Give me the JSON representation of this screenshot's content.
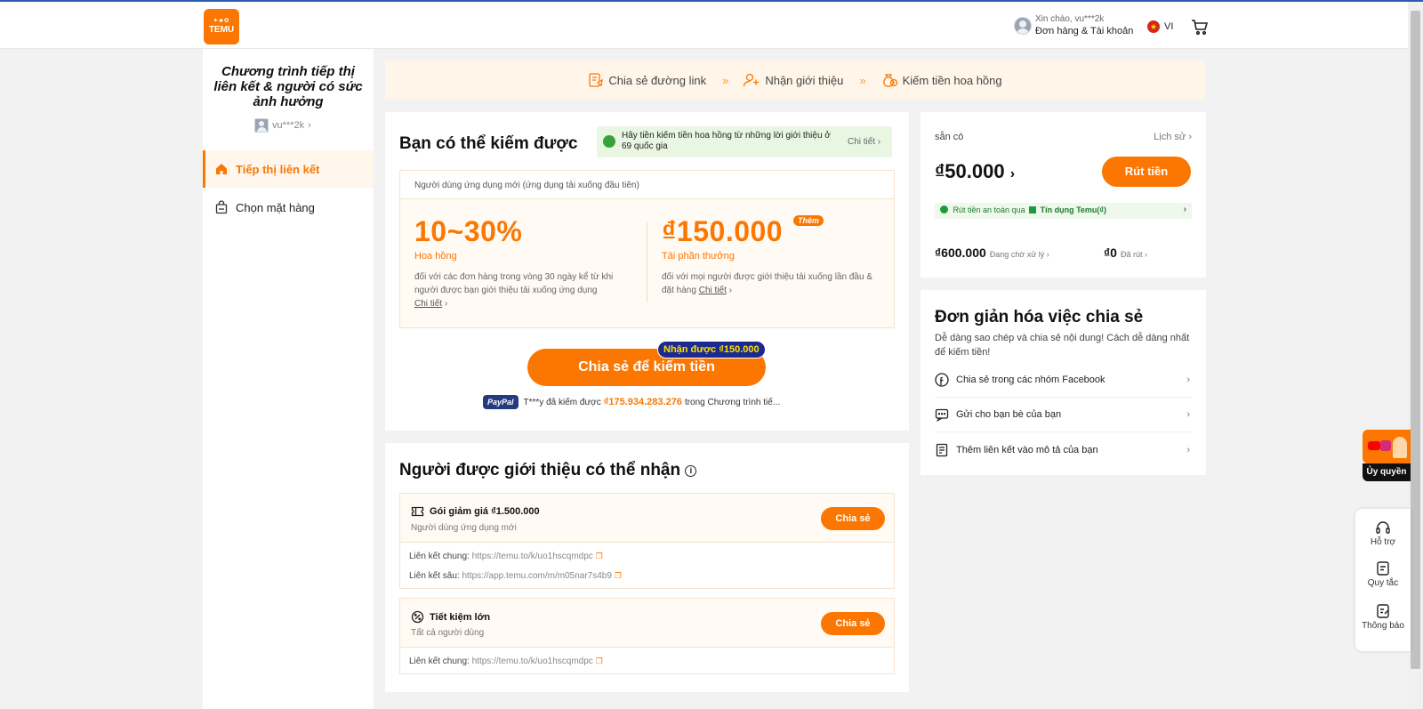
{
  "header": {
    "logo_text": "TEMU",
    "greeting": "Xin chào, vu***2k",
    "account_label": "Đơn hàng & Tài khoản",
    "language": "VI"
  },
  "sidebar": {
    "program_title": "Chương trình tiếp thị liên kết & người có sức ảnh hưởng",
    "username": "vu***2k",
    "items": [
      {
        "label": "Tiếp thị liên kết",
        "active": true,
        "icon": "home-icon"
      },
      {
        "label": "Chọn mặt hàng",
        "active": false,
        "icon": "bag-icon"
      }
    ]
  },
  "steps": [
    {
      "label": "Chia sẻ đường link",
      "icon": "share-link-icon"
    },
    {
      "label": "Nhận giới thiệu",
      "icon": "user-add-icon"
    },
    {
      "label": "Kiếm tiền hoa hồng",
      "icon": "money-bag-icon"
    }
  ],
  "steps_arrow": "»",
  "earn": {
    "title": "Bạn có thể kiếm được",
    "promo_text": "Hãy tiền kiếm tiền hoa hồng từ những lời giới thiệu ở 69 quốc gia",
    "promo_link": "Chi tiết",
    "box_header": "Người dùng ứng dụng mới (ứng dụng tải xuống đầu tiên)",
    "commission_value": "10~30%",
    "commission_label": "Hoa hồng",
    "commission_desc": "đối với các đơn hàng trong vòng 30 ngày kể từ khi người được bạn giới thiệu tải xuống ứng dụng",
    "commission_link": "Chi tiết",
    "reward_value": "₫150.000",
    "reward_badge": "Thêm",
    "reward_label": "Tải phần thưởng",
    "reward_desc": "đối với mọi người được giới thiệu tải xuống lần đầu & đặt hàng",
    "reward_link": "Chi tiết",
    "share_button": "Chia sẻ để kiếm tiền",
    "get_badge": "Nhận được ₫150.000",
    "paypal_label": "PayPal",
    "paypal_user_text": "T***y đã kiếm được",
    "paypal_amount": "₫175.934.283.276",
    "paypal_tail": "trong Chương trình tiế..."
  },
  "available": {
    "label": "sẵn có",
    "history": "Lịch sử",
    "balance": "₫50.000",
    "withdraw_button": "Rút tiền",
    "safe_text": "Rút tiền an toàn qua",
    "safe_credit": "Tín dụng Temu(₫)",
    "pending_amount": "₫600.000",
    "pending_label": "Đang chờ xử lý",
    "withdrawn_amount": "₫0",
    "withdrawn_label": "Đã rút"
  },
  "simplify": {
    "title": "Đơn giản hóa việc chia sẻ",
    "desc": "Dễ dàng sao chép và chia sẻ nội dung! Cách dễ dàng nhất để kiếm tiền!",
    "rows": [
      {
        "label": "Chia sẻ trong các nhóm Facebook",
        "icon": "facebook-icon"
      },
      {
        "label": "Gửi cho bạn bè của bạn",
        "icon": "message-icon"
      },
      {
        "label": "Thêm liên kết vào mô tả của bạn",
        "icon": "description-icon"
      }
    ]
  },
  "referral": {
    "title": "Người được giới thiệu có thể nhận",
    "offers": [
      {
        "name": "Gói giảm giá ₫1.500.000",
        "audience": "Người dùng ứng dụng mới",
        "button": "Chia sẻ",
        "links": [
          {
            "label": "Liên kết chung:",
            "url": "https://temu.to/k/uo1hscqmdpc"
          },
          {
            "label": "Liên kết sâu:",
            "url": "https://app.temu.com/m/m05nar7s4b9"
          }
        ]
      },
      {
        "name": "Tiết kiệm lớn",
        "audience": "Tất cả người dùng",
        "button": "Chia sẻ",
        "links": [
          {
            "label": "Liên kết chung:",
            "url": "https://temu.to/k/uo1hscqmdpc"
          }
        ]
      }
    ]
  },
  "floating": {
    "authorize_label": "Ủy quyền",
    "tools": [
      {
        "label": "Hỗ trợ",
        "icon": "headset-icon"
      },
      {
        "label": "Quy tắc",
        "icon": "rules-icon"
      },
      {
        "label": "Thông báo",
        "icon": "notice-icon"
      }
    ]
  },
  "colors": {
    "accent": "#fb7701",
    "brand_dark": "#1b2a8c",
    "success": "#1f9a3a"
  }
}
